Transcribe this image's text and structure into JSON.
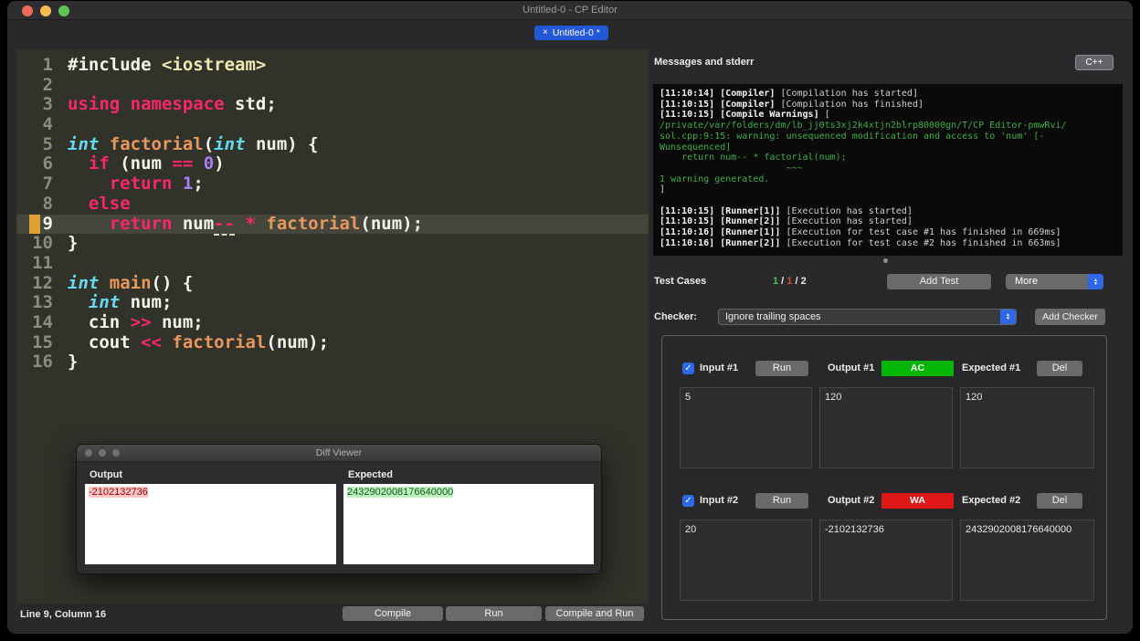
{
  "icons": {
    "close": "×",
    "check": "✓",
    "popup_up": "▲",
    "popup_down": "▼"
  },
  "colors": {
    "accent_blue": "#2c68e8",
    "ac_green": "#04b607",
    "wa_red": "#e01717",
    "warning_green": "#3fae46",
    "keyword_pink": "#f9266d",
    "type_cyan": "#67d8ef",
    "number_purple": "#ab7ef5"
  },
  "titlebar": {
    "title": "Untitled-0 - CP Editor"
  },
  "tabbar": {
    "tab": {
      "label": "Untitled-0 *"
    }
  },
  "editor": {
    "current_line": 9,
    "lines": [
      {
        "n": "1",
        "tokens": [
          [
            "pl",
            "#include "
          ],
          [
            "str",
            "<iostream>"
          ]
        ]
      },
      {
        "n": "2",
        "tokens": []
      },
      {
        "n": "3",
        "tokens": [
          [
            "kw",
            "using namespace"
          ],
          [
            "pl",
            " std;"
          ]
        ]
      },
      {
        "n": "4",
        "tokens": []
      },
      {
        "n": "5",
        "tokens": [
          [
            "ty",
            "int"
          ],
          [
            "pl",
            " "
          ],
          [
            "fn",
            "factorial"
          ],
          [
            "pl",
            "("
          ],
          [
            "ty",
            "int"
          ],
          [
            "pl",
            " num) {"
          ]
        ]
      },
      {
        "n": "6",
        "tokens": [
          [
            "pl",
            "  "
          ],
          [
            "kw",
            "if"
          ],
          [
            "pl",
            " (num "
          ],
          [
            "kw",
            "=="
          ],
          [
            "pl",
            " "
          ],
          [
            "num",
            "0"
          ],
          [
            "pl",
            ")"
          ]
        ]
      },
      {
        "n": "7",
        "tokens": [
          [
            "pl",
            "    "
          ],
          [
            "kw",
            "return"
          ],
          [
            "pl",
            " "
          ],
          [
            "num",
            "1"
          ],
          [
            "pl",
            ";"
          ]
        ]
      },
      {
        "n": "8",
        "tokens": [
          [
            "pl",
            "  "
          ],
          [
            "kw",
            "else"
          ]
        ]
      },
      {
        "n": "9",
        "tokens": [
          [
            "pl",
            "    "
          ],
          [
            "kw",
            "return"
          ],
          [
            "pl",
            " num"
          ],
          [
            "kwu",
            "--"
          ],
          [
            "pl",
            " "
          ],
          [
            "kw",
            "*"
          ],
          [
            "pl",
            " "
          ],
          [
            "fn",
            "factorial"
          ],
          [
            "pl",
            "(num);"
          ]
        ]
      },
      {
        "n": "10",
        "tokens": [
          [
            "pl",
            "}"
          ]
        ]
      },
      {
        "n": "11",
        "tokens": []
      },
      {
        "n": "12",
        "tokens": [
          [
            "ty",
            "int"
          ],
          [
            "pl",
            " "
          ],
          [
            "fn",
            "main"
          ],
          [
            "pl",
            "() {"
          ]
        ]
      },
      {
        "n": "13",
        "tokens": [
          [
            "pl",
            "  "
          ],
          [
            "ty",
            "int"
          ],
          [
            "pl",
            " num;"
          ]
        ]
      },
      {
        "n": "14",
        "tokens": [
          [
            "pl",
            "  cin "
          ],
          [
            "kw",
            ">>"
          ],
          [
            "pl",
            " num;"
          ]
        ]
      },
      {
        "n": "15",
        "tokens": [
          [
            "pl",
            "  cout "
          ],
          [
            "kw",
            "<<"
          ],
          [
            "pl",
            " "
          ],
          [
            "fn",
            "factorial"
          ],
          [
            "pl",
            "(num);"
          ]
        ]
      },
      {
        "n": "16",
        "tokens": [
          [
            "pl",
            "}"
          ]
        ]
      }
    ]
  },
  "messages": {
    "title": "Messages and stderr",
    "language_button": "C++",
    "console": [
      [
        [
          "b",
          "[11:10:14] [Compiler] "
        ],
        [
          "m",
          "[Compilation has started]"
        ]
      ],
      [
        [
          "b",
          "[11:10:15] [Compiler] "
        ],
        [
          "m",
          "[Compilation has finished]"
        ]
      ],
      [
        [
          "b",
          "[11:10:15] [Compile Warnings] "
        ],
        [
          "m",
          "["
        ]
      ],
      [
        [
          "g",
          "/private/var/folders/dm/lb_jj0ts3xj2k4xtjn2blrp80000gn/T/CP Editor-pmwRvi/"
        ]
      ],
      [
        [
          "g",
          "sol.cpp:9:15: warning: unsequenced modification and access to 'num' [-"
        ]
      ],
      [
        [
          "g",
          "Wunsequenced]"
        ]
      ],
      [
        [
          "g",
          "    return num-- * factorial(num);"
        ]
      ],
      [
        [
          "g",
          "                       ~~~"
        ]
      ],
      [
        [
          "g",
          "1 warning generated."
        ]
      ],
      [
        [
          "m",
          "]"
        ]
      ],
      [],
      [
        [
          "b",
          "[11:10:15] [Runner[1]] "
        ],
        [
          "m",
          "[Execution has started]"
        ]
      ],
      [
        [
          "b",
          "[11:10:15] [Runner[2]] "
        ],
        [
          "m",
          "[Execution has started]"
        ]
      ],
      [
        [
          "b",
          "[11:10:16] [Runner[1]] "
        ],
        [
          "m",
          "[Execution for test case #1 has finished in 669ms]"
        ]
      ],
      [
        [
          "b",
          "[11:10:16] [Runner[2]] "
        ],
        [
          "m",
          "[Execution for test case #2 has finished in 663ms]"
        ]
      ]
    ]
  },
  "test_cases": {
    "label": "Test Cases",
    "summary": [
      {
        "text": "1",
        "color": "green"
      },
      {
        "text": " / ",
        "color": "plain"
      },
      {
        "text": "1",
        "color": "red"
      },
      {
        "text": " / ",
        "color": "plain"
      },
      {
        "text": "2",
        "color": "plain"
      }
    ],
    "add_test_button": "Add Test",
    "more_button": "More",
    "checker_label": "Checker:",
    "checker_value": "Ignore trailing spaces",
    "add_checker_button": "Add Checker",
    "cases": [
      {
        "checked": true,
        "input_label": "Input #1",
        "run_button": "Run",
        "output_label": "Output #1",
        "verdict": "AC",
        "expected_label": "Expected #1",
        "del_button": "Del",
        "input": "5",
        "output": "120",
        "expected": "120"
      },
      {
        "checked": true,
        "input_label": "Input #2",
        "run_button": "Run",
        "output_label": "Output #2",
        "verdict": "WA",
        "expected_label": "Expected #2",
        "del_button": "Del",
        "input": "20",
        "output": "-2102132736",
        "expected": "2432902008176640000"
      }
    ]
  },
  "diff_viewer": {
    "title": "Diff Viewer",
    "output_label": "Output",
    "expected_label": "Expected",
    "output_value": "-2102132736",
    "expected_value": "2432902008176640000"
  },
  "statusbar": {
    "position": "Line 9, Column 16",
    "compile_button": "Compile",
    "run_button": "Run",
    "compile_run_button": "Compile and Run"
  }
}
